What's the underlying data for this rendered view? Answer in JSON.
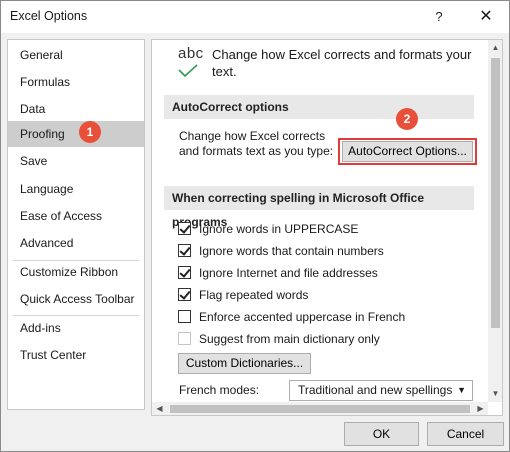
{
  "window": {
    "title": "Excel Options",
    "help": "?",
    "close": "✕"
  },
  "nav": {
    "items": [
      {
        "label": "General"
      },
      {
        "label": "Formulas"
      },
      {
        "label": "Data"
      },
      {
        "label": "Proofing"
      },
      {
        "label": "Save"
      },
      {
        "label": "Language"
      },
      {
        "label": "Ease of Access"
      },
      {
        "label": "Advanced"
      },
      {
        "label": "Customize Ribbon"
      },
      {
        "label": "Quick Access Toolbar"
      },
      {
        "label": "Add-ins"
      },
      {
        "label": "Trust Center"
      }
    ],
    "selected": "Proofing",
    "badge": "1"
  },
  "panel": {
    "icon_text": "abc",
    "header": "Change how Excel corrects and formats your text.",
    "autocorrect_section": "AutoCorrect options",
    "autocorrect_desc": "Change how Excel corrects and formats text as you type:",
    "autocorrect_button": "AutoCorrect Options...",
    "badge2": "2",
    "spelling_section": "When correcting spelling in Microsoft Office programs",
    "options": [
      {
        "label": "Ignore words in UPPERCASE",
        "checked": true
      },
      {
        "label": "Ignore words that contain numbers",
        "checked": true
      },
      {
        "label": "Ignore Internet and file addresses",
        "checked": true
      },
      {
        "label": "Flag repeated words",
        "checked": true
      },
      {
        "label": "Enforce accented uppercase in French",
        "checked": false
      },
      {
        "label": "Suggest from main dictionary only",
        "checked": false
      }
    ],
    "custom_dict_button": "Custom Dictionaries...",
    "french_modes_label": "French modes:",
    "french_modes_value": "Traditional and new spellings"
  },
  "footer": {
    "ok": "OK",
    "cancel": "Cancel"
  },
  "colors": {
    "accent_red": "#e03b3b",
    "badge": "#e8503a",
    "selected_nav": "#cdcdcd"
  }
}
